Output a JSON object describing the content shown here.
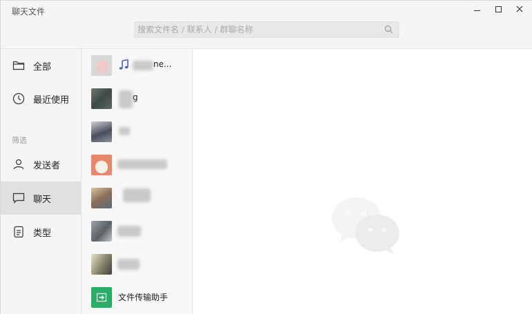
{
  "window": {
    "title": "聊天文件",
    "controls": {
      "minimize": "minimize-icon",
      "maximize": "maximize-icon",
      "close": "close-icon"
    }
  },
  "search": {
    "placeholder": "搜索文件名 / 联系人 / 群聊名称",
    "value": "",
    "icon": "search-icon"
  },
  "sidebar": {
    "items": [
      {
        "label": "全部",
        "icon": "folder-icon",
        "active": false
      },
      {
        "label": "最近使用",
        "icon": "clock-icon",
        "active": false
      }
    ],
    "section_label": "筛选",
    "filters": [
      {
        "label": "发送者",
        "icon": "person-icon",
        "active": false
      },
      {
        "label": "聊天",
        "icon": "chat-bubble-icon",
        "active": true
      },
      {
        "label": "类型",
        "icon": "document-icon",
        "active": false
      }
    ]
  },
  "contacts": [
    {
      "name_visible": "ne...",
      "blurred": true,
      "has_music_icon": true
    },
    {
      "name_visible": "g",
      "blurred": true
    },
    {
      "name_visible": "",
      "blurred": true
    },
    {
      "name_visible": "",
      "blurred": true
    },
    {
      "name_visible": "",
      "blurred": true
    },
    {
      "name_visible": "",
      "blurred": true
    },
    {
      "name_visible": "",
      "blurred": true
    },
    {
      "name_visible": "文件传输助手",
      "blurred": false,
      "icon": "file-transfer-icon"
    }
  ],
  "content": {
    "placeholder_icon": "wechat-logo-icon"
  },
  "colors": {
    "accent_green": "#2aae67",
    "sidebar_bg": "#f5f5f5",
    "active_bg": "#e0e0e0"
  }
}
